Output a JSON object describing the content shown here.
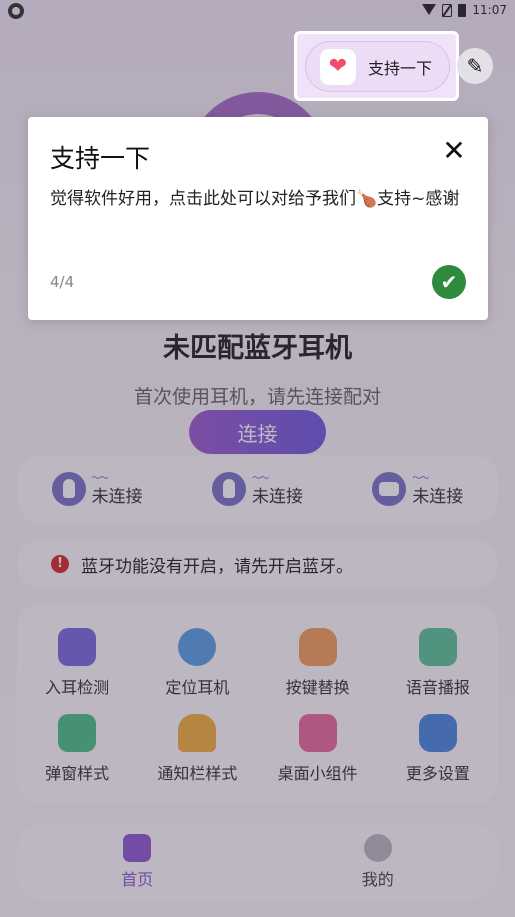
{
  "status_bar": {
    "time": "11:07"
  },
  "hero": {
    "title": "未匹配蓝牙耳机",
    "subtitle": "首次使用耳机，请先连接配对",
    "connect_label": "连接"
  },
  "devices": [
    {
      "icon": "left-earbud-icon",
      "battery": "〜〜",
      "status": "未连接"
    },
    {
      "icon": "right-earbud-icon",
      "battery": "〜〜",
      "status": "未连接"
    },
    {
      "icon": "charging-case-icon",
      "battery": "〜〜",
      "status": "未连接"
    }
  ],
  "bluetooth_warning": "蓝牙功能没有开启，请先开启蓝牙。",
  "features": [
    {
      "label": "入耳检测",
      "icon": "in-ear-detection-icon",
      "color": "#7a6be0"
    },
    {
      "label": "定位耳机",
      "icon": "locate-icon",
      "color": "#5aa0e6"
    },
    {
      "label": "按键替换",
      "icon": "tap-gesture-icon",
      "color": "#f0a060"
    },
    {
      "label": "语音播报",
      "icon": "megaphone-icon",
      "color": "#5cc49a"
    },
    {
      "label": "弹窗样式",
      "icon": "popup-style-icon",
      "color": "#4cc08a"
    },
    {
      "label": "通知栏样式",
      "icon": "bell-icon",
      "color": "#f0b040"
    },
    {
      "label": "桌面小组件",
      "icon": "widget-puzzle-icon",
      "color": "#e86aa0"
    },
    {
      "label": "更多设置",
      "icon": "settings-hex-icon",
      "color": "#4a86e0"
    }
  ],
  "tabs": [
    {
      "label": "首页",
      "icon": "home-tab-icon",
      "active": true
    },
    {
      "label": "我的",
      "icon": "profile-tab-icon",
      "active": false
    }
  ],
  "top_actions": {
    "support_label": "支持一下",
    "support_icon": "heart-icon",
    "edit_icon": "pencil-icon"
  },
  "guide_dialog": {
    "title": "支持一下",
    "body": "觉得软件好用，点击此处可以对给予我们🍗支持~感谢",
    "step": "4/4"
  },
  "colors": {
    "accent": "#8e5ad6",
    "warning": "#d82a2a",
    "confirm": "#2e8b3e"
  }
}
